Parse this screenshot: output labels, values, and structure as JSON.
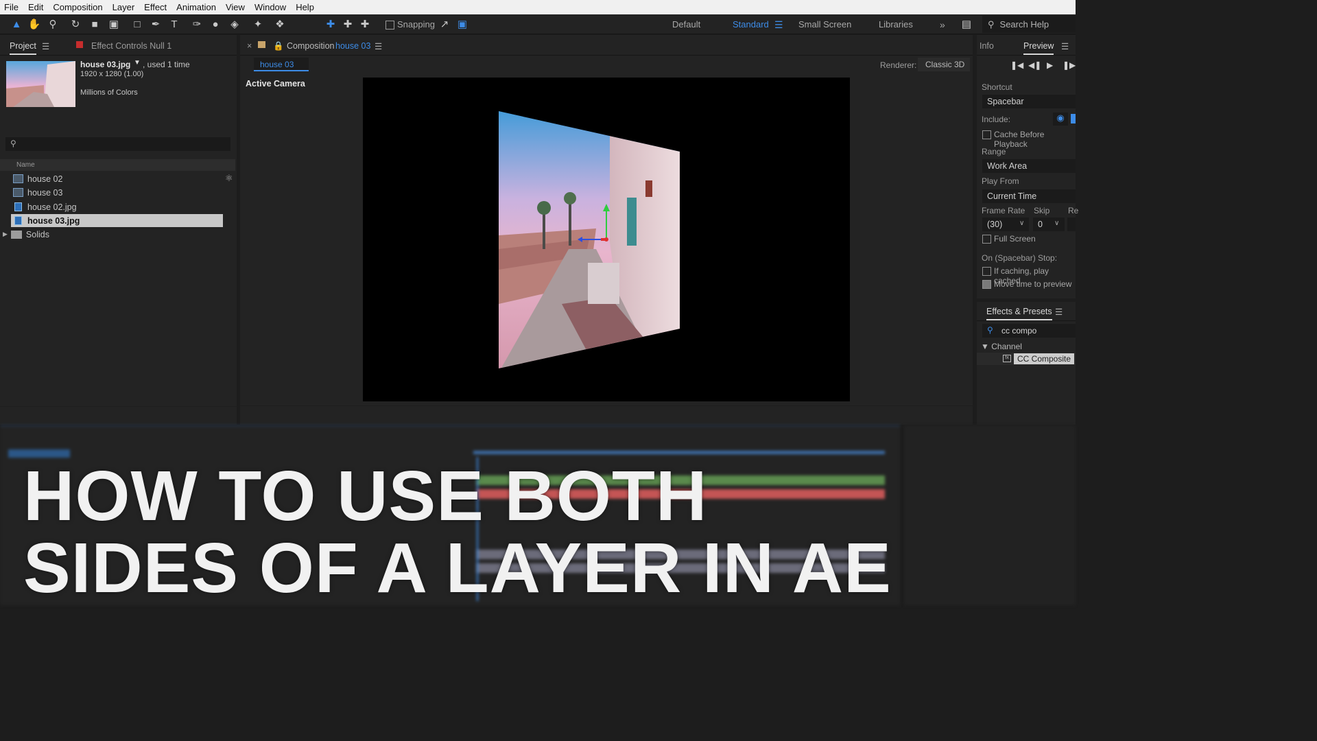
{
  "menu": [
    "File",
    "Edit",
    "Composition",
    "Layer",
    "Effect",
    "Animation",
    "View",
    "Window",
    "Help"
  ],
  "toolbar": {
    "snapping_label": "Snapping",
    "workspaces": [
      "Default",
      "Standard",
      "Small Screen",
      "Libraries"
    ],
    "active_workspace": "Standard",
    "search_placeholder": "Search Help"
  },
  "project_panel": {
    "tab_project": "Project",
    "tab_effect_controls": "Effect Controls Null 1",
    "asset_name": "house 03.jpg",
    "asset_used": ", used 1 time",
    "asset_dims": "1920 x 1280 (1.00)",
    "asset_colors": "Millions of Colors",
    "column_name": "Name",
    "items": [
      {
        "label": "house 02",
        "type": "comp"
      },
      {
        "label": "house 03",
        "type": "comp"
      },
      {
        "label": "house 02.jpg",
        "type": "image"
      },
      {
        "label": "house 03.jpg",
        "type": "image",
        "selected": true
      },
      {
        "label": "Solids",
        "type": "folder"
      }
    ]
  },
  "composition_panel": {
    "tab_prefix": "Composition",
    "tab_name": "house 03",
    "subtab": "house 03",
    "renderer_label": "Renderer:",
    "renderer_value": "Classic 3D",
    "view_label": "Active Camera"
  },
  "info_panel": {
    "tab_info": "Info",
    "tab_preview": "Preview",
    "shortcut_label": "Shortcut",
    "shortcut_value": "Spacebar",
    "include_label": "Include:",
    "cache_before": "Cache Before Playback",
    "range_label": "Range",
    "range_value": "Work Area",
    "play_from_label": "Play From",
    "play_from_value": "Current Time",
    "frame_rate_label": "Frame Rate",
    "frame_rate_value": "(30)",
    "skip_label": "Skip",
    "skip_value": "0",
    "res_label": "Re",
    "full_screen": "Full Screen",
    "on_stop_label": "On (Spacebar) Stop:",
    "if_caching": "If caching, play cached",
    "move_time": "Move time to preview"
  },
  "effects_panel": {
    "title": "Effects & Presets",
    "search_value": "cc compo",
    "category": "Channel",
    "effect": "CC Composite"
  },
  "headline": {
    "line1": "HOW TO USE BOTH",
    "line2": "SIDES OF A LAYER IN AE"
  },
  "colors": {
    "accent": "#3d8ce7",
    "selected_row": "#c8c8c8",
    "panel_bg": "#232323"
  }
}
